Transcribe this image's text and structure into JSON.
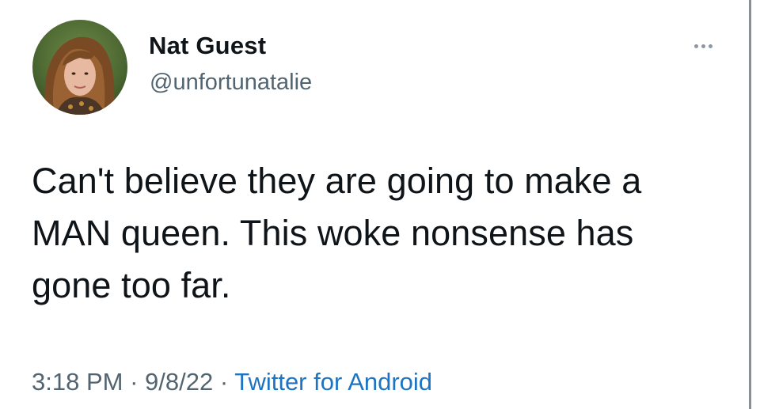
{
  "tweet": {
    "author": {
      "display_name": "Nat Guest",
      "handle": "@unfortunatalie"
    },
    "text_lines": [
      "Can't believe they are going to make a",
      "MAN queen. This woke nonsense has",
      "gone too far."
    ],
    "meta": {
      "time": "3:18 PM",
      "separator": " · ",
      "date": "9/8/22",
      "source": "Twitter for Android"
    },
    "icons": {
      "more": "more-horizontal-icon"
    },
    "colors": {
      "text": "#0f1419",
      "secondary": "#536471",
      "link": "#1d74c2"
    }
  }
}
